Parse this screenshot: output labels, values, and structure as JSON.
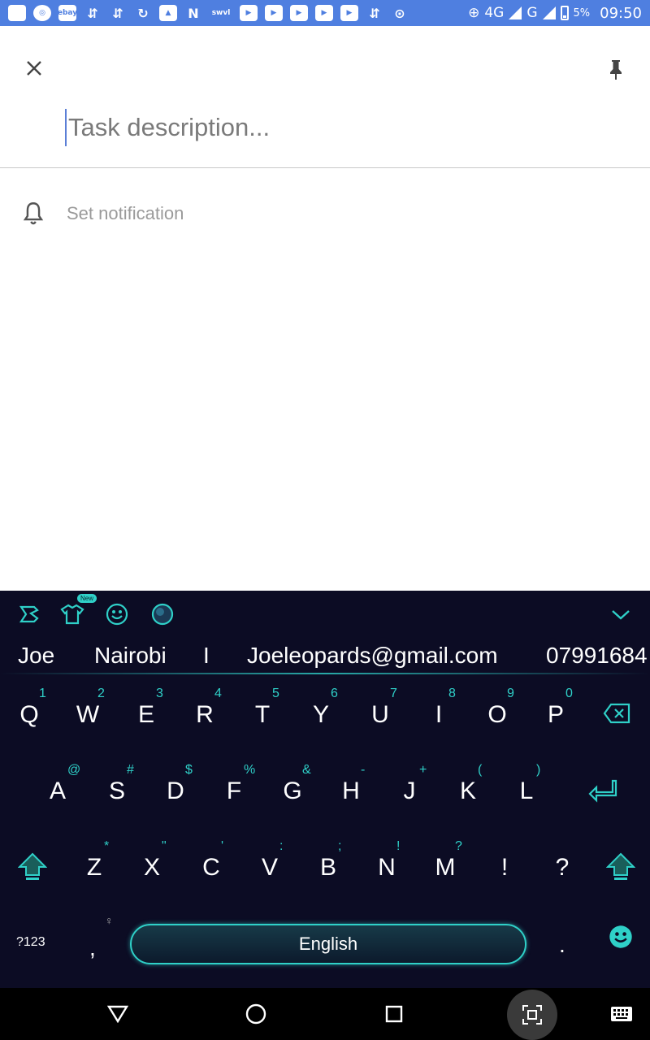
{
  "status_bar": {
    "app_icons": [
      "square-icon",
      "chrome-icon",
      "ebay-icon",
      "usb-icon",
      "usb-icon",
      "sync-icon",
      "image-icon",
      "n-app-icon",
      "swvl-icon",
      "youtube-icon",
      "youtube-icon",
      "youtube-icon",
      "youtube-icon",
      "youtube-icon",
      "usb-icon",
      "free-icon"
    ],
    "ebay_label": "ebay",
    "swvl_label": "swvl",
    "network_4g": "4G",
    "network_g": "G",
    "battery": "5%",
    "time": "09:50"
  },
  "editor": {
    "placeholder": "Task description...",
    "notification_label": "Set notification"
  },
  "keyboard": {
    "new_badge": "New",
    "suggestions": [
      "Joe",
      "Nairobi",
      "I",
      "Joeleopards@gmail.com",
      "07991684"
    ],
    "row1": [
      {
        "key": "Q",
        "hint": "1"
      },
      {
        "key": "W",
        "hint": "2"
      },
      {
        "key": "E",
        "hint": "3"
      },
      {
        "key": "R",
        "hint": "4"
      },
      {
        "key": "T",
        "hint": "5"
      },
      {
        "key": "Y",
        "hint": "6"
      },
      {
        "key": "U",
        "hint": "7"
      },
      {
        "key": "I",
        "hint": "8"
      },
      {
        "key": "O",
        "hint": "9"
      },
      {
        "key": "P",
        "hint": "0"
      }
    ],
    "row2": [
      {
        "key": "A",
        "hint": "@"
      },
      {
        "key": "S",
        "hint": "#"
      },
      {
        "key": "D",
        "hint": "$"
      },
      {
        "key": "F",
        "hint": "%"
      },
      {
        "key": "G",
        "hint": "&"
      },
      {
        "key": "H",
        "hint": "-"
      },
      {
        "key": "J",
        "hint": "+"
      },
      {
        "key": "K",
        "hint": "("
      },
      {
        "key": "L",
        "hint": ")"
      }
    ],
    "row3": [
      {
        "key": "Z",
        "hint": "*"
      },
      {
        "key": "X",
        "hint": "\""
      },
      {
        "key": "C",
        "hint": "'"
      },
      {
        "key": "V",
        "hint": ":"
      },
      {
        "key": "B",
        "hint": ";"
      },
      {
        "key": "N",
        "hint": "!"
      },
      {
        "key": "M",
        "hint": "?"
      },
      {
        "key": "!",
        "hint": ""
      },
      {
        "key": "?",
        "hint": ""
      }
    ],
    "symbols_label": "?123",
    "comma": ",",
    "space_label": "English",
    "period": "."
  },
  "colors": {
    "status_bar": "#4f7fe0",
    "keyboard_bg": "#0c0c24",
    "accent": "#2fd0c8"
  }
}
